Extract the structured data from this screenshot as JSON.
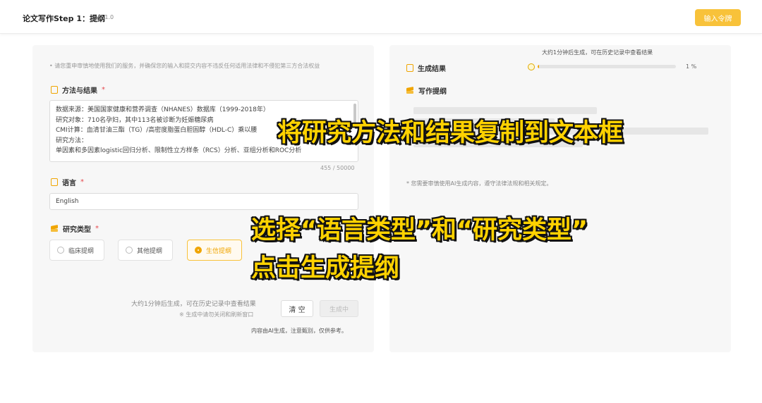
{
  "header": {
    "title": "论文写作Step 1：提纲",
    "version": "v2.1.0",
    "command_button": "输入令牌"
  },
  "left": {
    "notice": "• 请您重申审慎地使用我们的服务，并确保您的输入和提交内容不违反任何适用法律和不侵犯第三方合法权益",
    "methods": {
      "label": "方法与结果",
      "required": "*",
      "lines": [
        "数据来源：美国国家健康和营养调查（NHANES）数据库（1999-2018年）",
        "研究对象：710名孕妇，其中113名被诊断为妊娠糖尿病",
        "CMI计算：血清甘油三酯（TG）/高密度脂蛋白胆固醇（HDL-C）乘以腰",
        "研究方法：",
        "单因素和多因素logistic回归分析、限制性立方样条（RCS）分析、亚组分析和ROC分析"
      ],
      "counter": "455 / 50000"
    },
    "language": {
      "label": "语言",
      "required": "*",
      "value": "English"
    },
    "study_type": {
      "label": "研究类型",
      "required": "*",
      "options": [
        "临床提纲",
        "其他提纲",
        "生信提纲"
      ],
      "selected": "生信提纲"
    },
    "estimate": "大约1分钟后生成，可在历史记录中查看结果",
    "warning": "※ 生成中请勿关闭和刷新窗口",
    "clear_button": "清 空",
    "generate_button": "生成中",
    "ai_note": "内容由AI生成，注意甄别，仅供参考。"
  },
  "right": {
    "estimate": "大约1分钟后生成，可在历史记录中查看结果",
    "progress_percent": 1,
    "progress_label": "1 %",
    "result_title": "生成结果",
    "outline_title": "写作提纲",
    "notice": "* 您需要审慎使用AI生成内容，遵守法律法规和相关规定。"
  },
  "overlays": {
    "line1": "将研究方法和结果复制到文本框",
    "line2": "选择“语言类型”和“研究类型”",
    "line3": "点击生成提纲"
  },
  "colors": {
    "accent": "#f0a500",
    "button": "#f8c23a",
    "overlay_text": "#ffd200"
  }
}
